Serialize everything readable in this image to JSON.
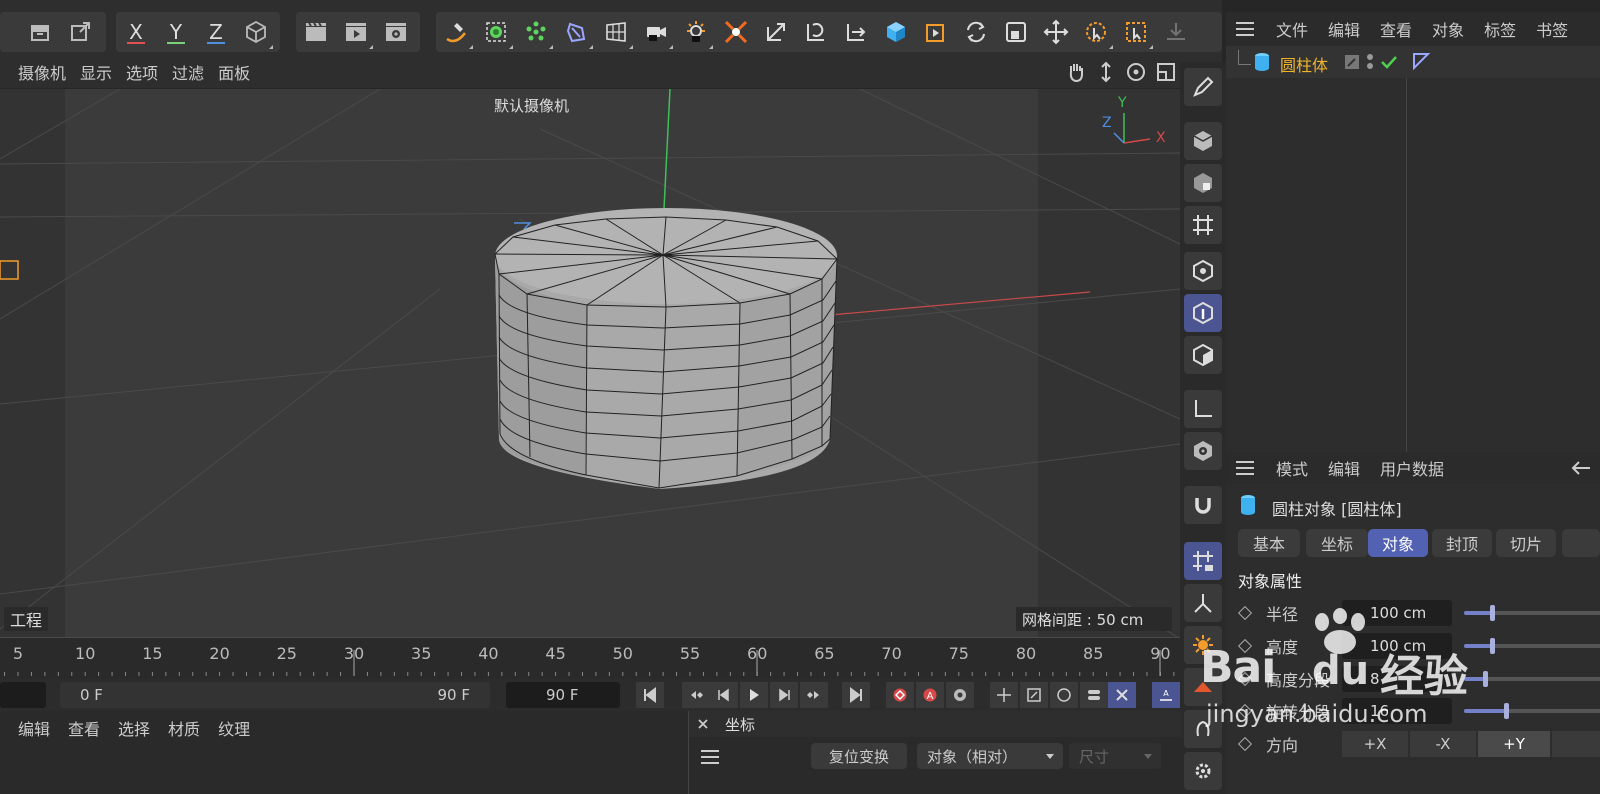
{
  "toolbar": {
    "axis_x": "X",
    "axis_y": "Y",
    "axis_z": "Z",
    "colors": {
      "x": "#e05252",
      "y": "#7bd17b",
      "z": "#4f8fe0",
      "accent": "#f39c2b"
    }
  },
  "viewport_menu": {
    "camera": "摄像机",
    "display": "显示",
    "options": "选项",
    "filter": "过滤",
    "panel": "面板"
  },
  "viewport": {
    "camera_label": "默认摄像机",
    "project_label": "工程",
    "grid_label": "网格间距 : 50 cm",
    "axis_gizmo": {
      "y": "Y",
      "z": "Z",
      "x": "X"
    }
  },
  "object_manager": {
    "menu": [
      "文件",
      "编辑",
      "查看",
      "对象",
      "标签",
      "书签"
    ],
    "objects": [
      {
        "name": "圆柱体",
        "color": "#f0b429"
      }
    ]
  },
  "attribute_manager": {
    "menu": [
      "模式",
      "编辑",
      "用户数据"
    ],
    "title": "圆柱对象 [圆柱体]",
    "tabs": [
      "基本",
      "坐标",
      "对象",
      "封顶",
      "切片"
    ],
    "active_tab": "对象",
    "section_title": "对象属性",
    "properties": [
      {
        "label": "半径",
        "value": "100 cm",
        "slider": 0.2
      },
      {
        "label": "高度",
        "value": "100 cm",
        "slider": 0.2
      },
      {
        "label": "高度分段",
        "value": "8",
        "slider": 0.15
      },
      {
        "label": "旋转分段",
        "value": "16",
        "slider": 0.3
      }
    ],
    "orientation": {
      "label": "方向",
      "options": [
        "+X",
        "-X",
        "+Y"
      ],
      "selected": "+Y"
    }
  },
  "timeline": {
    "ticks": [
      "5",
      "10",
      "15",
      "20",
      "25",
      "30",
      "35",
      "40",
      "45",
      "50",
      "55",
      "60",
      "65",
      "70",
      "75",
      "80",
      "85",
      "90"
    ],
    "start_frame": "0 F",
    "end_frame": "90 F",
    "current_frame": "90 F"
  },
  "material_manager": {
    "menu": [
      "编辑",
      "查看",
      "选择",
      "材质",
      "纹理"
    ]
  },
  "coordinates": {
    "title": "坐标",
    "reset_button": "复位变换",
    "mode_select": "对象（相对）",
    "size_select": "尺寸"
  },
  "watermark": {
    "brand": "Bai",
    "brand2": "经验",
    "url": "jingyan.baidu.com"
  }
}
